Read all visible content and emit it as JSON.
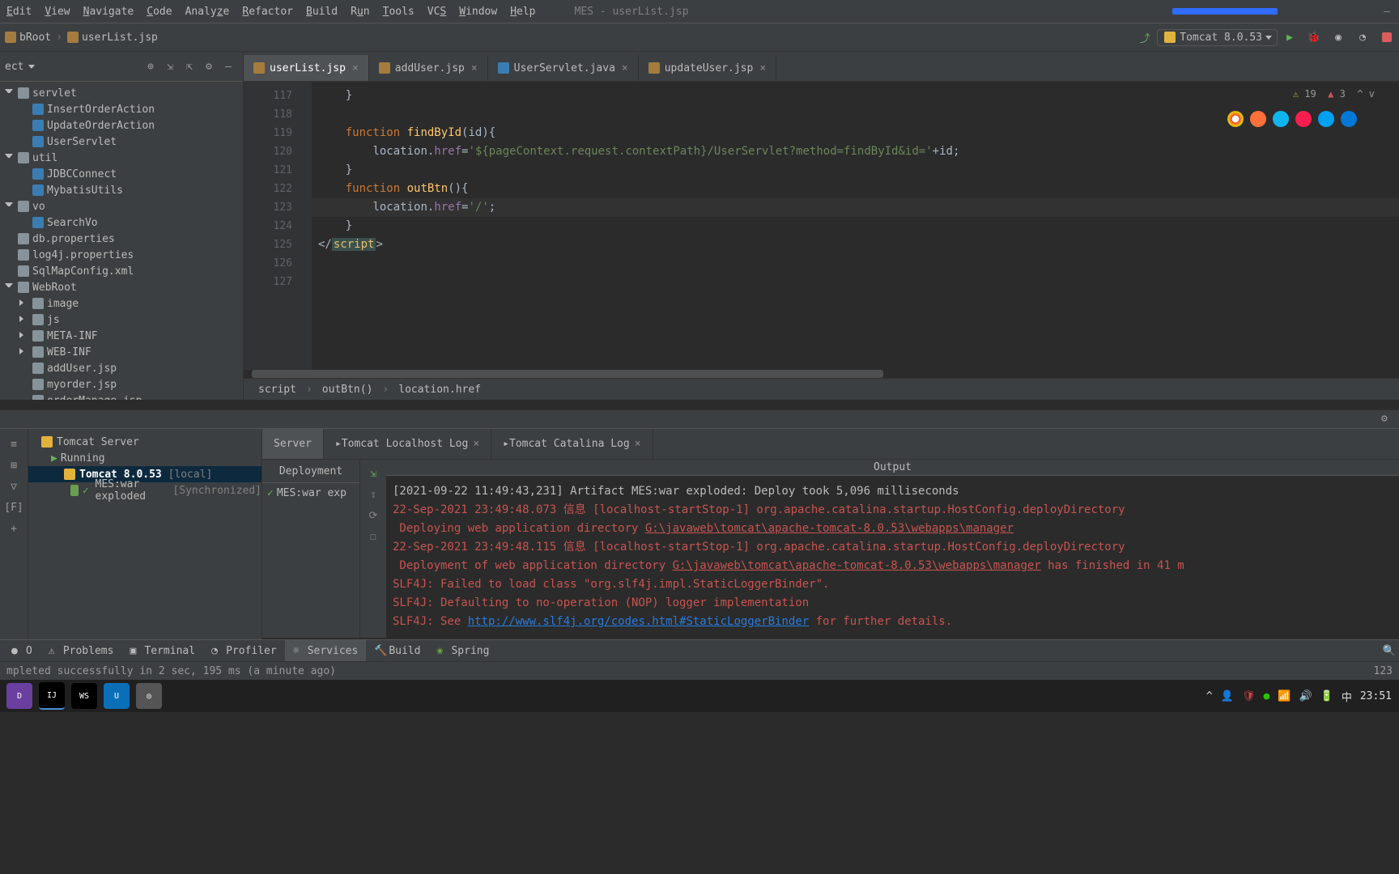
{
  "menu": [
    "Edit",
    "View",
    "Navigate",
    "Code",
    "Analyze",
    "Refactor",
    "Build",
    "Run",
    "Tools",
    "VCS",
    "Window",
    "Help"
  ],
  "window_title": "MES - userList.jsp",
  "nav_crumbs": [
    "bRoot",
    "userList.jsp"
  ],
  "run_config": "Tomcat 8.0.53",
  "project_label": "ect",
  "tree": [
    {
      "indent": 0,
      "type": "open-folder",
      "label": "servlet"
    },
    {
      "indent": 1,
      "type": "class",
      "label": "InsertOrderAction"
    },
    {
      "indent": 1,
      "type": "class",
      "label": "UpdateOrderAction"
    },
    {
      "indent": 1,
      "type": "class",
      "label": "UserServlet"
    },
    {
      "indent": 0,
      "type": "open-folder",
      "label": "util"
    },
    {
      "indent": 1,
      "type": "class",
      "label": "JDBCConnect"
    },
    {
      "indent": 1,
      "type": "class",
      "label": "MybatisUtils"
    },
    {
      "indent": 0,
      "type": "open-folder",
      "label": "vo"
    },
    {
      "indent": 1,
      "type": "class",
      "label": "SearchVo"
    },
    {
      "indent": 0,
      "type": "file",
      "label": "db.properties"
    },
    {
      "indent": 0,
      "type": "file",
      "label": "log4j.properties"
    },
    {
      "indent": 0,
      "type": "file",
      "label": "SqlMapConfig.xml"
    },
    {
      "indent": 0,
      "type": "open-folder",
      "label": "WebRoot"
    },
    {
      "indent": 1,
      "type": "closed-folder",
      "label": "image"
    },
    {
      "indent": 1,
      "type": "closed-folder",
      "label": "js"
    },
    {
      "indent": 1,
      "type": "closed-folder",
      "label": "META-INF"
    },
    {
      "indent": 1,
      "type": "closed-folder",
      "label": "WEB-INF"
    },
    {
      "indent": 1,
      "type": "file",
      "label": "addUser.jsp"
    },
    {
      "indent": 1,
      "type": "file",
      "label": "myorder.jsp"
    },
    {
      "indent": 1,
      "type": "file",
      "label": "orderManage.jsp"
    }
  ],
  "editor_tabs": [
    {
      "label": "userList.jsp",
      "active": true,
      "icon": "jsp"
    },
    {
      "label": "addUser.jsp",
      "active": false,
      "icon": "jsp"
    },
    {
      "label": "UserServlet.java",
      "active": false,
      "icon": "java"
    },
    {
      "label": "updateUser.jsp",
      "active": false,
      "icon": "jsp"
    }
  ],
  "inspection": {
    "warn": "19",
    "err": "3"
  },
  "gutter": [
    "117",
    "118",
    "119",
    "120",
    "121",
    "122",
    "123",
    "124",
    "125",
    "126",
    "127"
  ],
  "code_bc": [
    "script",
    "outBtn()",
    "location.href"
  ],
  "svc_left_tree": {
    "root": "Tomcat Server",
    "running": "Running",
    "cfg": "Tomcat 8.0.53",
    "cfg_hint": "[local]",
    "art": "MES:war exploded",
    "art_hint": "[Synchronized]"
  },
  "svc_tabs": [
    "Server",
    "Tomcat Localhost Log",
    "Tomcat Catalina Log"
  ],
  "dep_hdr": "Deployment",
  "dep_item": "MES:war exp",
  "out_hdr": "Output",
  "out": {
    "l1": "[2021-09-22 11:49:43,231] Artifact MES:war exploded: Deploy took 5,096 milliseconds",
    "l2a": "22-Sep-2021 23:49:48.073 信息 [localhost-startStop-1] org.apache.catalina.startup.HostConfig.deployDirectory",
    "l2b_pre": " Deploying web application directory ",
    "l2b_link": "G:\\javaweb\\tomcat\\apache-tomcat-8.0.53\\webapps\\manager",
    "l3a": "22-Sep-2021 23:49:48.115 信息 [localhost-startStop-1] org.apache.catalina.startup.HostConfig.deployDirectory",
    "l3b_pre": " Deployment of web application directory ",
    "l3b_link": "G:\\javaweb\\tomcat\\apache-tomcat-8.0.53\\webapps\\manager",
    "l3b_post": " has finished in 41 m",
    "l4": "SLF4J: Failed to load class \"org.slf4j.impl.StaticLoggerBinder\".",
    "l5": "SLF4J: Defaulting to no-operation (NOP) logger implementation",
    "l6_pre": "SLF4J: See ",
    "l6_link": "http://www.slf4j.org/codes.html#StaticLoggerBinder",
    "l6_post": " for further details."
  },
  "bottom_tabs": [
    "O",
    "Problems",
    "Terminal",
    "Profiler",
    "Services",
    "Build",
    "Spring"
  ],
  "status_msg": "mpleted successfully in 2 sec, 195 ms (a minute ago)",
  "status_right": "123",
  "tray_time": "23:51",
  "tray_ime": "中"
}
